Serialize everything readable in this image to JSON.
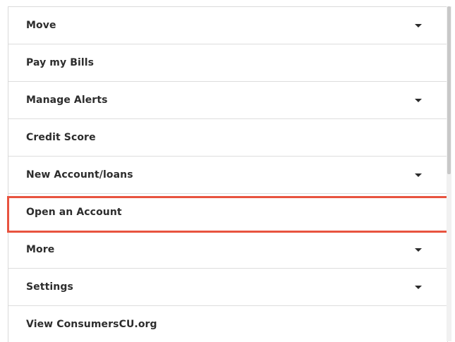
{
  "menu": {
    "items": [
      {
        "label": "Move",
        "expandable": true
      },
      {
        "label": "Pay my Bills",
        "expandable": false
      },
      {
        "label": "Manage Alerts",
        "expandable": true
      },
      {
        "label": "Credit Score",
        "expandable": false
      },
      {
        "label": "New Account/loans",
        "expandable": true
      },
      {
        "label": "Open an Account",
        "expandable": false,
        "highlighted": true
      },
      {
        "label": "More",
        "expandable": true
      },
      {
        "label": "Settings",
        "expandable": true
      },
      {
        "label": "View ConsumersCU.org",
        "expandable": false
      }
    ]
  },
  "colors": {
    "highlight": "#e8533f",
    "text": "#2d2d2d",
    "divider": "#dddddd"
  },
  "icons": {
    "expand": "chevron-down-icon"
  }
}
